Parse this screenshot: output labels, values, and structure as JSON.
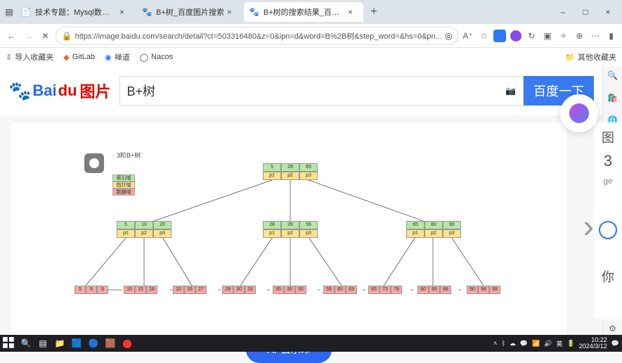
{
  "tabs": [
    {
      "title": "技术专题：Mysql数据库（视图..."
    },
    {
      "title": "B+树_百度图片搜索"
    },
    {
      "title": "B+树的搜索结果_百度图片搜索"
    }
  ],
  "winbtn": {
    "min": "–",
    "max": "□",
    "close": "×"
  },
  "url": "https://image.baidu.com/search/detail?ct=503316480&z=0&ipn=d&word=B%2B树&step_word=&hs=0&pn...",
  "placeholder": "",
  "fav": {
    "import": "导入收藏夹",
    "gitlab": "GitLab",
    "zen": "禅道",
    "nacos": "Nacos",
    "other": "其他收藏夹"
  },
  "logo_text": "图片",
  "search_value": "B+树",
  "search_btn": "百度一下",
  "tree_title": "3阶B+树",
  "legend": [
    "索引域",
    "指针域",
    "数据域"
  ],
  "root": {
    "keys": [
      "5",
      "28",
      "65"
    ],
    "ptrs": [
      "p1",
      "p2",
      "p3"
    ]
  },
  "l2": [
    {
      "keys": [
        "5",
        "10",
        "20"
      ],
      "ptrs": [
        "p1",
        "p2",
        "p3"
      ]
    },
    {
      "keys": [
        "28",
        "35",
        "56"
      ],
      "ptrs": [
        "p1",
        "p2",
        "p3"
      ]
    },
    {
      "keys": [
        "65",
        "80",
        "90"
      ],
      "ptrs": [
        "p1",
        "p2",
        "p3"
      ]
    }
  ],
  "leaves": [
    [
      "5",
      "8",
      "9"
    ],
    [
      "10",
      "15",
      "18"
    ],
    [
      "20",
      "26",
      "27"
    ],
    [
      "28",
      "30",
      "33"
    ],
    [
      "35",
      "38",
      "50"
    ],
    [
      "56",
      "60",
      "63"
    ],
    [
      "65",
      "73",
      "79"
    ],
    [
      "80",
      "85",
      "88"
    ],
    [
      "90",
      "98",
      "99"
    ]
  ],
  "remove_wm": "去水印",
  "ai_label": "AI",
  "side": [
    "图",
    "3",
    "ge",
    "你"
  ],
  "clock": {
    "time": "10:22",
    "date": "2024/3/12"
  }
}
